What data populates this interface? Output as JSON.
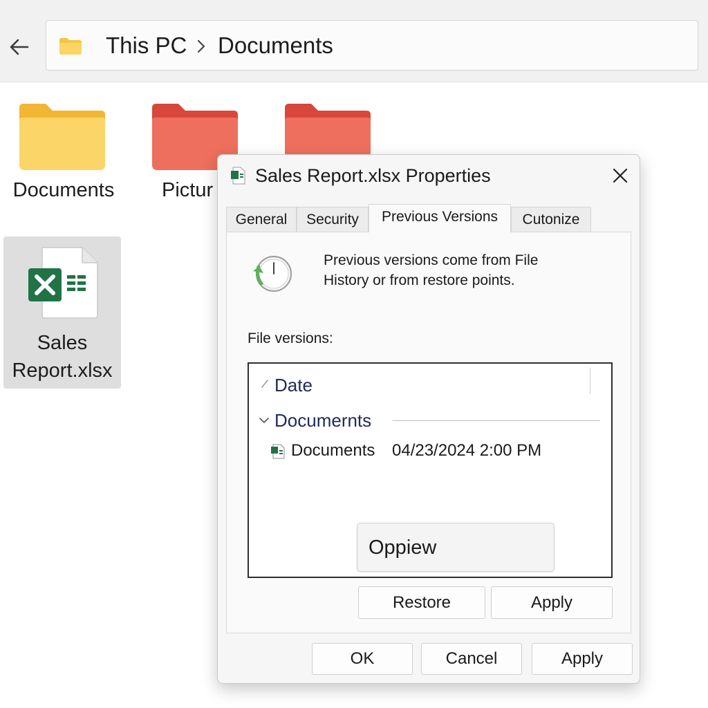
{
  "explorer": {
    "breadcrumb": [
      "This PC",
      "Documents"
    ],
    "items": [
      {
        "label": "Documents",
        "type": "folder-yellow"
      },
      {
        "label": "Pictur",
        "type": "folder-red"
      },
      {
        "label": "",
        "type": "folder-red"
      }
    ],
    "selected_file": {
      "label_line1": "Sales",
      "label_line2": "Report.xlsx",
      "type": "excel-file"
    }
  },
  "dialog": {
    "title": "Sales Report.xlsx Properties",
    "tabs": [
      "General",
      "Security",
      "Previous Versions",
      "Cutonize"
    ],
    "active_tab": "Previous Versions",
    "info_line1": "Previous versions come from File",
    "info_line2": "History or from restore points.",
    "versions_label": "File versions:",
    "list": {
      "column_header": "Date",
      "group_title": "Documernts",
      "rows": [
        {
          "name": "Documents",
          "date": "04/23/2024 2:00 PM"
        }
      ]
    },
    "buttons": {
      "open": "Oppiew",
      "restore": "Restore",
      "apply_inner": "Apply",
      "ok": "OK",
      "cancel": "Cancel",
      "apply": "Apply"
    }
  },
  "colors": {
    "folder_yellow": "#f7c948",
    "folder_red": "#e8574a",
    "excel_green": "#217346",
    "selection_bg": "#dedede",
    "list_text": "#1f2a5a"
  },
  "icons": [
    "back-arrow-icon",
    "folder-icon",
    "chevron-right-icon",
    "excel-icon",
    "close-icon",
    "history-clock-icon",
    "chevron-down-icon",
    "sort-icon"
  ]
}
